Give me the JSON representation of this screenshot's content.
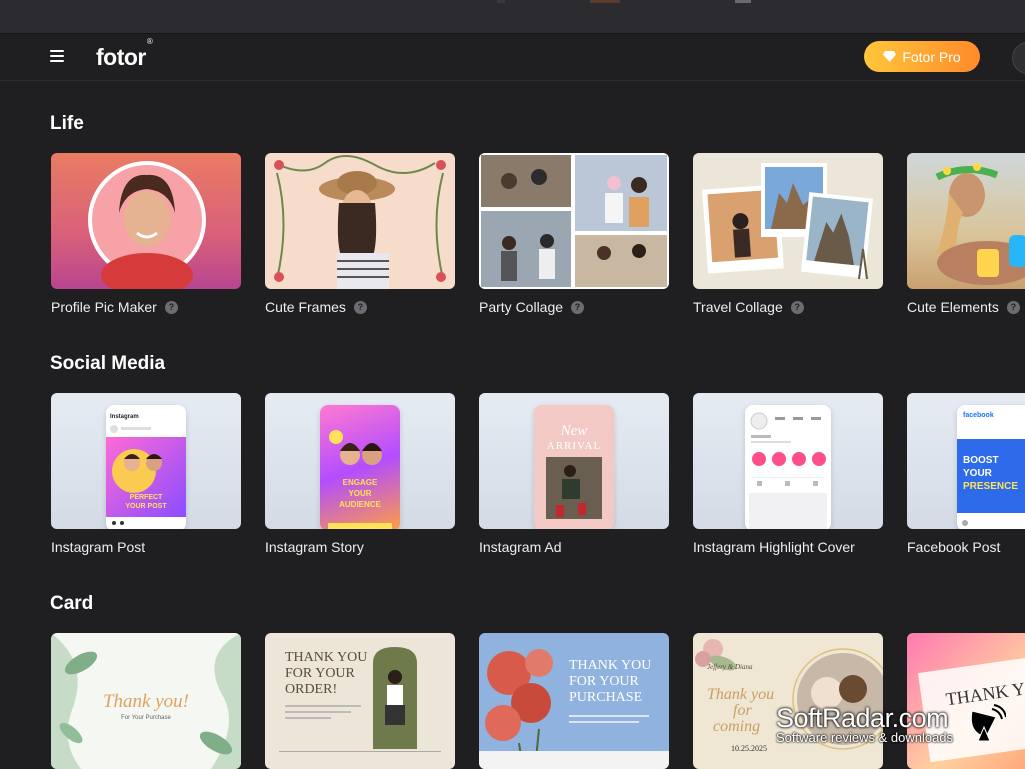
{
  "header": {
    "logo": "fotor",
    "logo_mark": "®",
    "pro_label": "Fotor Pro"
  },
  "sections": [
    {
      "title": "Life",
      "items": [
        {
          "label": "Profile Pic Maker",
          "help": "?"
        },
        {
          "label": "Cute Frames",
          "help": "?"
        },
        {
          "label": "Party Collage",
          "help": "?"
        },
        {
          "label": "Travel Collage",
          "help": "?"
        },
        {
          "label": "Cute Elements",
          "help": "?"
        }
      ]
    },
    {
      "title": "Social Media",
      "items": [
        {
          "label": "Instagram Post",
          "thumb_text": "PERFECT YOUR POST"
        },
        {
          "label": "Instagram Story",
          "thumb_text": "ENGAGE YOUR AUDIENCE"
        },
        {
          "label": "Instagram Ad",
          "thumb_text": "New ARRIVAL"
        },
        {
          "label": "Instagram Highlight Cover"
        },
        {
          "label": "Facebook Post",
          "thumb_text": "BOOST YOUR PRESENCE"
        }
      ]
    },
    {
      "title": "Card",
      "items": [
        {
          "thumb_text": "Thank you!",
          "thumb_sub": "For Your Purchase"
        },
        {
          "thumb_text": "THANK YOU FOR YOUR ORDER!"
        },
        {
          "thumb_text": "THANK YOU FOR YOUR PURCHASE"
        },
        {
          "thumb_text": "Thank you for coming",
          "thumb_sub": "Jeffery & Diana",
          "thumb_date": "10.25.2025"
        },
        {
          "thumb_text": "THANK Y"
        }
      ]
    }
  ],
  "watermark": {
    "title": "SoftRadar.com",
    "subtitle": "Software reviews & downloads"
  },
  "colors": {
    "background": "#1f1e21",
    "accent_start": "#ffc73a",
    "accent_end": "#ff8a2b"
  }
}
